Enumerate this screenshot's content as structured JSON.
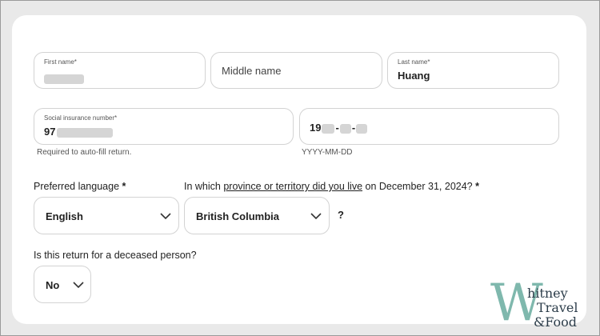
{
  "form": {
    "first_name": {
      "label": "First name",
      "required_mark": "*"
    },
    "middle_name": {
      "placeholder": "Middle name"
    },
    "last_name": {
      "label": "Last name",
      "required_mark": "*",
      "value": "Huang"
    },
    "sin": {
      "label": "Social insurance number",
      "required_mark": "*",
      "value_prefix": "97",
      "helper": "Required to auto-fill return."
    },
    "dob": {
      "value_prefix": "19",
      "sep1": "-",
      "sep2": "-",
      "helper": "YYYY-MM-DD"
    },
    "preferred_language": {
      "label": "Preferred language",
      "required_mark": "*",
      "value": "English"
    },
    "province": {
      "label_pre": "In which ",
      "label_link": "province or territory did you live",
      "label_post": " on December 31, 2024?",
      "required_mark": "*",
      "value": "British Columbia",
      "help": "?"
    },
    "deceased": {
      "label": "Is this return for a deceased person?",
      "value": "No"
    }
  },
  "watermark": {
    "line1": "hitney",
    "line2": "Travel",
    "line3": "&Food",
    "letter": "W"
  },
  "icons": {
    "chevron": "chevron-down-icon"
  }
}
